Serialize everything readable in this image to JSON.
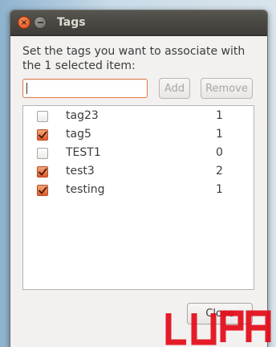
{
  "window": {
    "title": "Tags"
  },
  "dialog": {
    "instruction": "Set the tags you want to associate with the 1 selected item:",
    "input": {
      "value": "",
      "placeholder": ""
    },
    "add_label": "Add",
    "remove_label": "Remove",
    "close_label": "Close"
  },
  "tags": [
    {
      "name": "tag23",
      "count": "1",
      "checked": false
    },
    {
      "name": "tag5",
      "count": "1",
      "checked": true
    },
    {
      "name": "TEST1",
      "count": "0",
      "checked": false
    },
    {
      "name": "test3",
      "count": "2",
      "checked": true
    },
    {
      "name": "testing",
      "count": "1",
      "checked": true
    }
  ],
  "watermark": {
    "text": "LUPA"
  },
  "colors": {
    "accent": "#e0592a",
    "titlebar": "#3c3b37",
    "watermark": "#e30613"
  },
  "icons": [
    "close-icon",
    "minimize-icon",
    "checkmark-icon"
  ]
}
